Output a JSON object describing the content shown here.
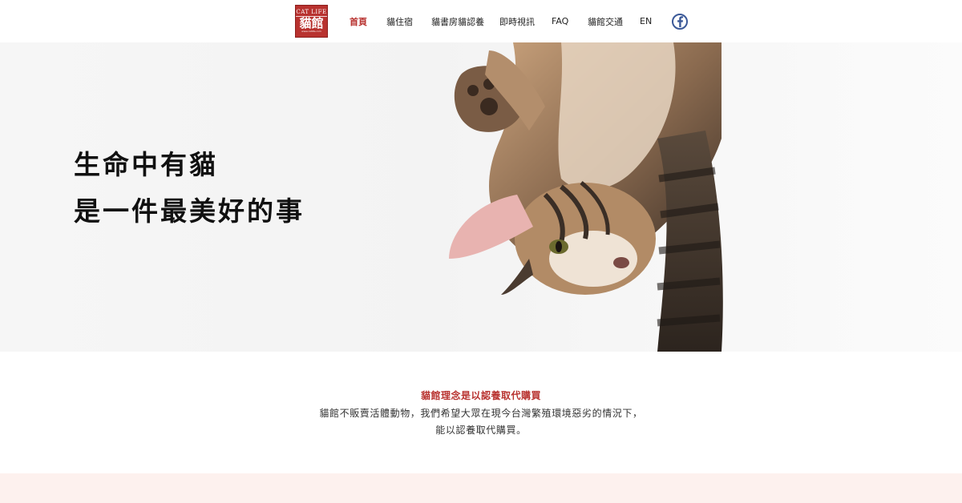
{
  "header": {
    "logo": {
      "top_text": "CAT LIFE",
      "main_text": "貓館",
      "url_text": "www.catlife.com"
    },
    "nav": [
      {
        "label": "首頁",
        "active": true
      },
      {
        "label": "貓住宿",
        "active": false
      },
      {
        "label": "貓書房貓認養",
        "active": false
      },
      {
        "label": "即時視訊",
        "active": false
      },
      {
        "label": "FAQ",
        "active": false
      },
      {
        "label": "貓館交通",
        "active": false
      },
      {
        "label": "EN",
        "active": false
      }
    ],
    "social_icon": "facebook-icon"
  },
  "hero": {
    "line1": "生命中有貓",
    "line2": "是一件最美好的事",
    "image": "upside-down tabby cat photo"
  },
  "philosophy": {
    "title": "貓館理念是以認養取代購買",
    "line1": "貓館不販賣活體動物，我們希望大眾在現今台灣繁殖環境惡劣的情況下，",
    "line2": "能以認養取代購買。"
  },
  "colors": {
    "accent": "#b8322f",
    "facebook": "#3b5998",
    "band": "#fdf1ee"
  }
}
